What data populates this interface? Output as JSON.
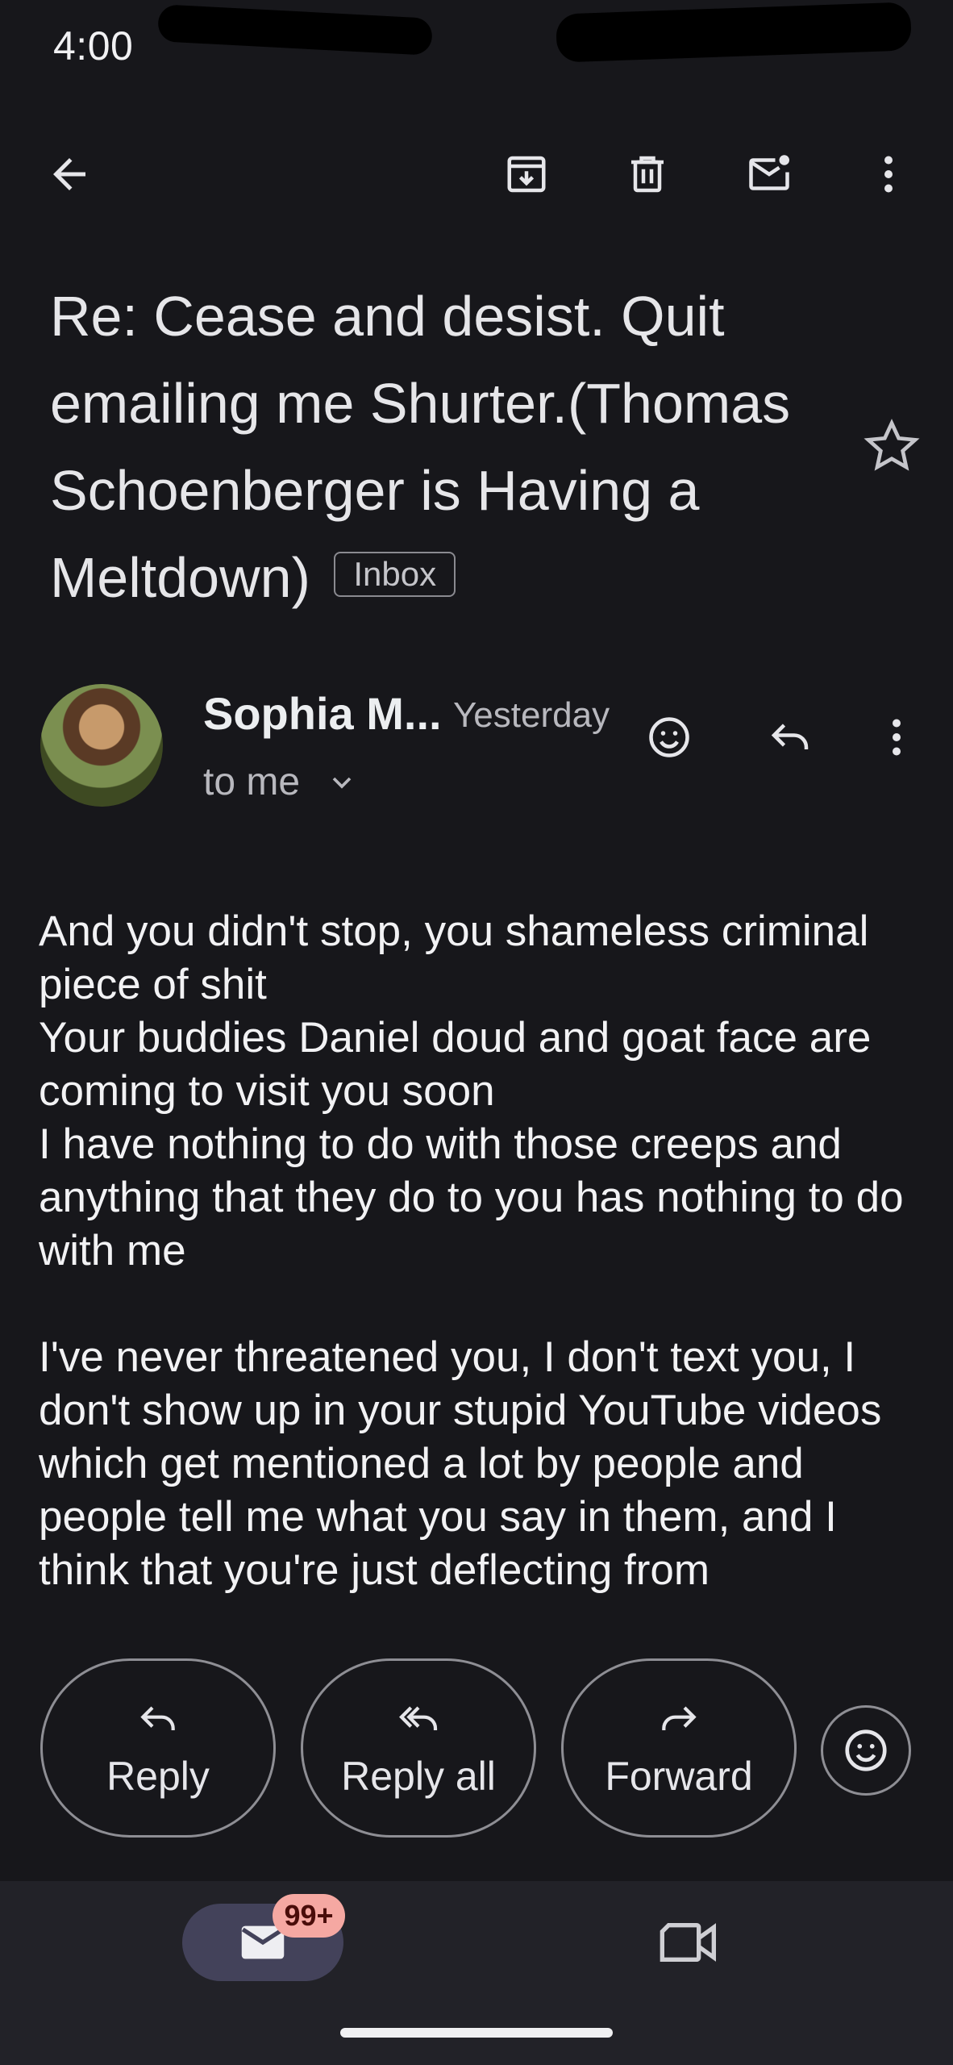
{
  "status_bar": {
    "time": "4:00"
  },
  "toolbar": {
    "back": "back-arrow-icon",
    "archive": "archive-icon",
    "delete": "delete-icon",
    "mark_unread": "mark-unread-icon",
    "more": "more-vert-icon"
  },
  "email": {
    "subject": "Re: Cease and desist. Quit emailing me Shurter.(Thomas Schoenberger is Having a Meltdown)",
    "label": "Inbox",
    "starred": false,
    "sender": "Sophia M...",
    "time": "Yesterday",
    "recipient": "to me",
    "body": "And you didn't stop, you  shameless criminal piece of shit\nYour buddies Daniel doud and goat face are coming to visit you soon\nI have nothing to do with those creeps and anything that they do to you has nothing to do with me\n\nI've never threatened you, I don't text you, I don't show up in your stupid YouTube videos which get mentioned a lot by people and people tell me what you say in them, and I think that you're just deflecting from"
  },
  "actions": {
    "reply": "Reply",
    "reply_all": "Reply all",
    "forward": "Forward"
  },
  "bottom_nav": {
    "mail_badge": "99+",
    "items": [
      "mail-icon",
      "video-meet-icon"
    ]
  },
  "colors": {
    "background": "#17171b",
    "nav_background": "#222228",
    "active_pill": "#43425a",
    "badge": "#f5a8a2"
  }
}
